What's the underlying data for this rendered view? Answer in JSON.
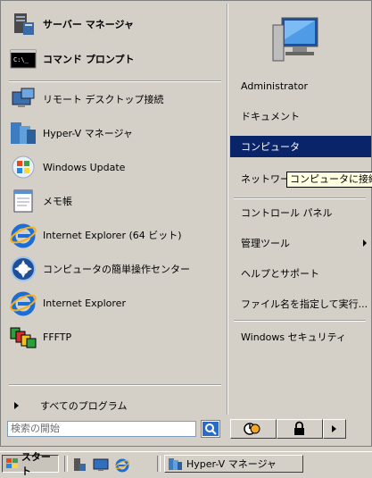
{
  "left_pinned": [
    {
      "label": "サーバー マネージャ",
      "icon": "server-manager-icon"
    },
    {
      "label": "コマンド プロンプト",
      "icon": "command-prompt-icon"
    }
  ],
  "left_recent": [
    {
      "label": "リモート デスクトップ接続",
      "icon": "remote-desktop-icon"
    },
    {
      "label": "Hyper-V マネージャ",
      "icon": "hyper-v-icon"
    },
    {
      "label": "Windows Update",
      "icon": "windows-update-icon"
    },
    {
      "label": "メモ帳",
      "icon": "notepad-icon"
    },
    {
      "label": "Internet Explorer (64 ビット)",
      "icon": "internet-explorer-icon"
    },
    {
      "label": "コンピュータの簡単操作センター",
      "icon": "ease-of-access-icon"
    },
    {
      "label": "Internet Explorer",
      "icon": "internet-explorer-icon"
    },
    {
      "label": "FFFTP",
      "icon": "ffftp-icon"
    }
  ],
  "all_programs": "すべてのプログラム",
  "search": {
    "placeholder": "検索の開始"
  },
  "right_items": [
    {
      "label": "Administrator"
    },
    {
      "label": "ドキュメント"
    },
    {
      "label": "コンピュータ",
      "selected": true
    },
    {
      "label": "ネットワーク"
    },
    {
      "label": "コントロール パネル"
    },
    {
      "label": "管理ツール",
      "has_submenu": true
    },
    {
      "label": "ヘルプとサポート"
    },
    {
      "label": "ファイル名を指定して実行..."
    },
    {
      "label": "Windows セキュリティ"
    }
  ],
  "tooltip": "コンピュータに接続し",
  "taskbar": {
    "start_label": "スタート",
    "task_label": "Hyper-V マネージャ"
  },
  "colors": {
    "selection": "#0a246a",
    "face": "#d4d0c8",
    "tooltip": "#ffffe1"
  }
}
